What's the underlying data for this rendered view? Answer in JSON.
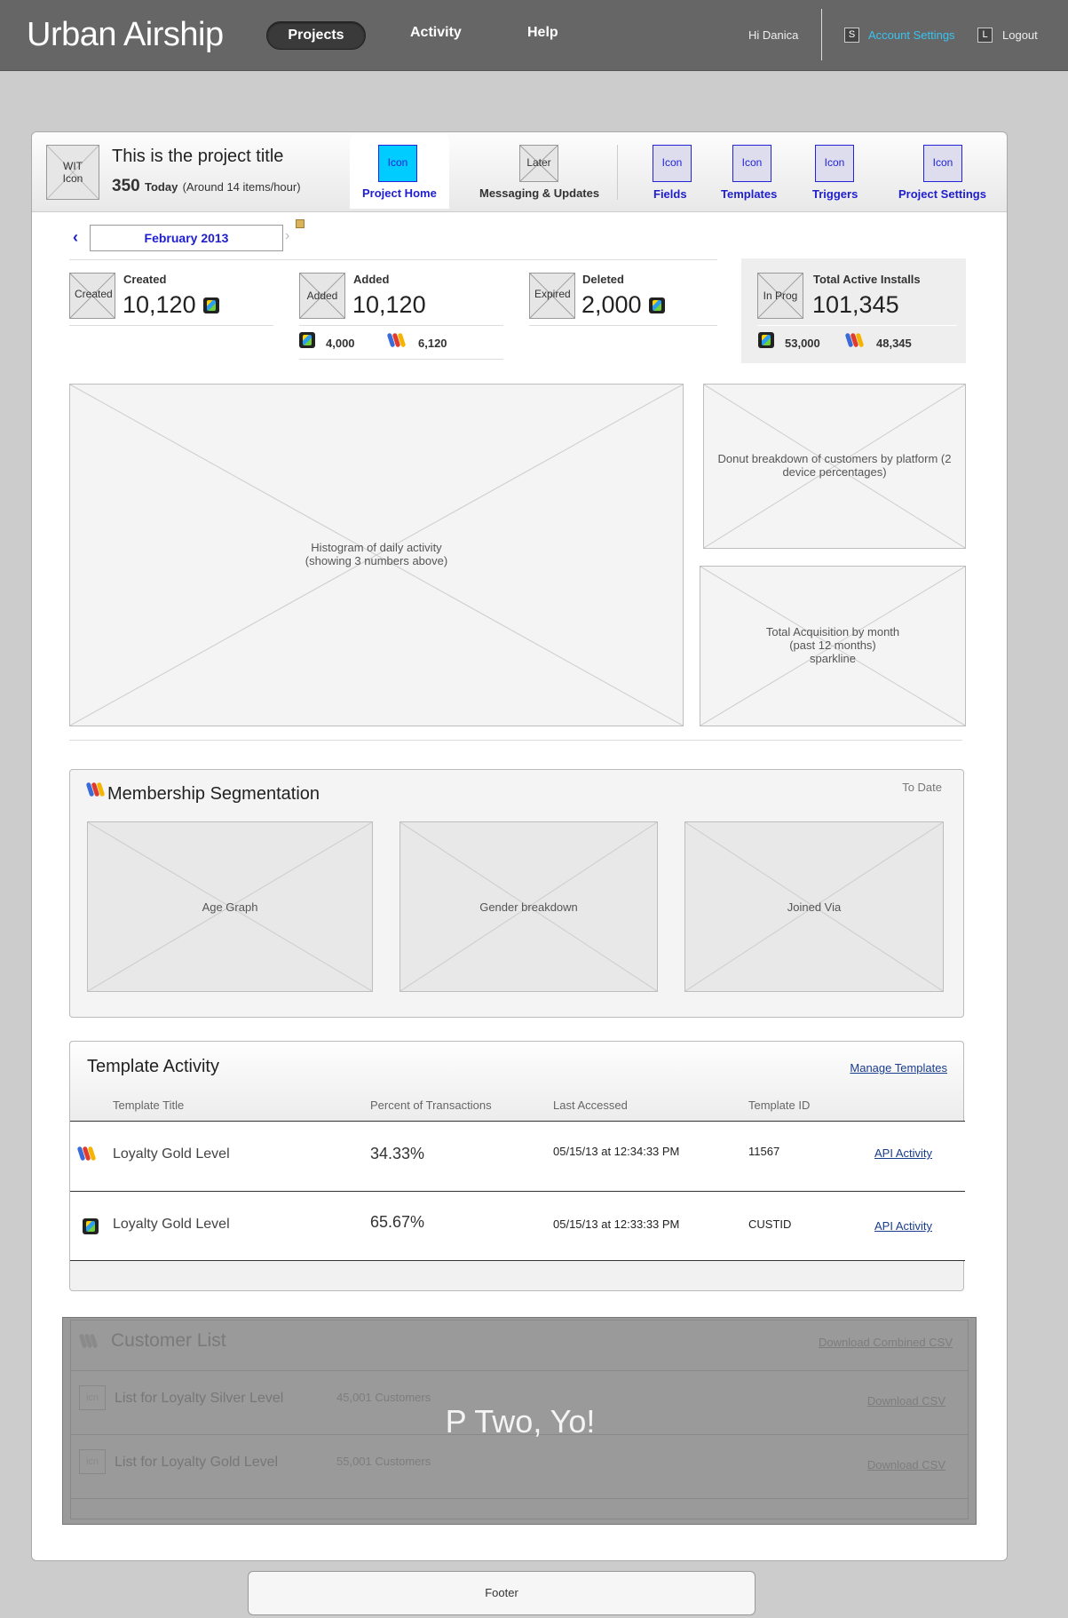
{
  "header": {
    "brand": "Urban Airship",
    "nav": [
      "Projects",
      "Activity",
      "Help"
    ],
    "greeting": "Hi Danica",
    "account_key": "S",
    "account_label": "Account Settings",
    "logout_key": "L",
    "logout_label": "Logout",
    "accent_color": "#39c3f0"
  },
  "project": {
    "icon_label": "WIT Icon",
    "title": "This is the project title",
    "today_count": "350",
    "today_label": "Today",
    "rate": "(Around 14 items/hour)",
    "tabs": [
      {
        "icon": "Icon",
        "label": "Project Home"
      },
      {
        "icon": "Later",
        "label": "Messaging & Updates"
      },
      {
        "icon": "Icon",
        "label": "Fields"
      },
      {
        "icon": "Icon",
        "label": "Templates"
      },
      {
        "icon": "Icon",
        "label": "Triggers"
      },
      {
        "icon": "Icon",
        "label": "Project Settings"
      }
    ]
  },
  "date": {
    "prev": "‹",
    "current": "February 2013",
    "next": "›"
  },
  "stats": [
    {
      "icon": "Created",
      "label": "Created",
      "value": "10,120"
    },
    {
      "icon": "Added",
      "label": "Added",
      "value": "10,120",
      "ios": "4,000",
      "android": "6,120"
    },
    {
      "icon": "Expired",
      "label": "Deleted",
      "value": "2,000"
    },
    {
      "icon": "In Prog",
      "label": "Total Active Installs",
      "value": "101,345",
      "ios": "53,000",
      "android": "48,345"
    }
  ],
  "placeholders": {
    "histogram": [
      "Histogram of daily activity",
      "(showing 3 numbers above)"
    ],
    "donut": [
      "Donut breakdown of customers by platform (2",
      "device percentages)"
    ],
    "acquisition": [
      "Total Acquisition by month",
      "(past 12 months)",
      "sparkline"
    ]
  },
  "segmentation": {
    "title": "Membership Segmentation",
    "range": "To Date",
    "charts": [
      "Age Graph",
      "Gender breakdown",
      "Joined Via"
    ]
  },
  "template_activity": {
    "title": "Template Activity",
    "manage_link": "Manage Templates",
    "columns": [
      "Template Title",
      "Percent of Transactions",
      "Last Accessed",
      "Template ID"
    ],
    "rows": [
      {
        "title": "Loyalty Gold Level",
        "percent": "34.33%",
        "accessed": "05/15/13 at 12:34:33 PM",
        "id": "11567",
        "link": "API Activity"
      },
      {
        "title": "Loyalty Gold Level",
        "percent": "65.67%",
        "accessed": "05/15/13 at 12:33:33 PM",
        "id": "CUSTID",
        "link": "API Activity"
      }
    ]
  },
  "customer_list": {
    "title": "Customer List",
    "combined_link": "Download Combined CSV",
    "overlay": "P Two, Yo!",
    "rows": [
      {
        "icon": "icn",
        "name": "List for Loyalty Silver Level",
        "count": "45,001 Customers",
        "link": "Download CSV"
      },
      {
        "icon": "icn",
        "name": "List for Loyalty Gold Level",
        "count": "55,001 Customers",
        "link": "Download CSV"
      }
    ]
  },
  "footer": "Footer"
}
